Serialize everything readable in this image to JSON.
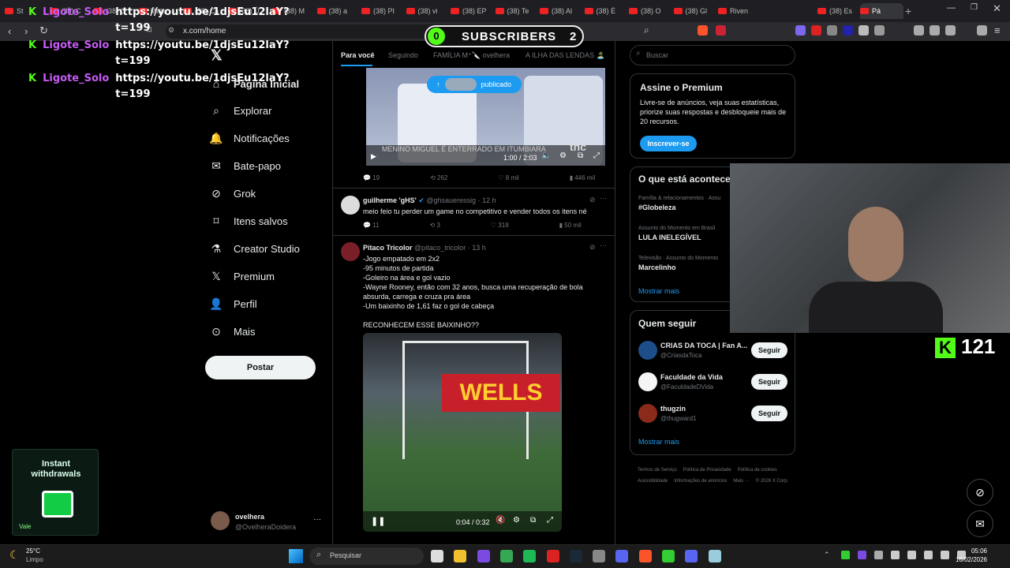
{
  "browser": {
    "tabs": [
      "St",
      "(38) C",
      "(38) O",
      "Male",
      "(38) Ca",
      "(38) Ú",
      "(38) M",
      "(38) a",
      "(38) PI",
      "(38) vi",
      "(38) EP",
      "(38) Te",
      "(38) Al",
      "(38) É",
      "(38) O",
      "(38) Gl",
      "Riven",
      "(38) Es",
      "Pá"
    ],
    "url": "x.com/home"
  },
  "stream": {
    "subscribers_label": "SUBSCRIBERS",
    "subscribers_left": "0",
    "subscribers_right": "2",
    "viewer_count": "121",
    "promo_title": "Instant withdrawals",
    "promo_badge": "Vale"
  },
  "chat": [
    {
      "user": "Ligote_Solo",
      "msg": "https://youtu.be/1djsEu12laY?t=199"
    },
    {
      "user": "Ligote_Solo",
      "msg": "https://youtu.be/1djsEu12laY?t=199"
    },
    {
      "user": "Ligote_Solo",
      "msg": "https://youtu.be/1djsEu12laY?t=199"
    }
  ],
  "nav": {
    "items": [
      "Página Inicial",
      "Explorar",
      "Notificações",
      "Bate-papo",
      "Grok",
      "Itens salvos",
      "Creator Studio",
      "Premium",
      "Perfil",
      "Mais"
    ],
    "post_label": "Postar",
    "account_name": "ovelhera",
    "account_handle": "@OvelheraDoidera"
  },
  "feed": {
    "tabs": [
      "Para você",
      "Seguindo",
      "FAMÍLIA M⁺🔪 ovelhera",
      "A ILHA DAS LENDAS 🏝️"
    ],
    "published_pill": "publicado",
    "video1": {
      "caption": "MENINO MIGUEL É ENTERRADO EM ITUMBIARA",
      "time": "1:00 / 2:03",
      "brand": "tnc"
    },
    "video1_stats": [
      "19",
      "262",
      "8 mil",
      "446 mil"
    ],
    "tweet2": {
      "name": "guilherme 'gHS'",
      "handle": "@ghsaueressig",
      "age": "12 h",
      "text": "meio feio tu perder um game no competitivo e vender todos os itens né",
      "stats": [
        "11",
        "3",
        "318",
        "50 mil"
      ]
    },
    "tweet3": {
      "name": "Pitaco Tricolor",
      "handle": "@pitaco_tricolor",
      "age": "13 h",
      "lines": [
        "-Jogo empatado em 2x2",
        "-95 minutos de partida",
        "-Goleiro na área e gol vazio",
        "-Wayne Rooney, então com 32 anos, busca uma recuperação de bola absurda, carrega e cruza pra área",
        "-Um baixinho de 1,61 faz o gol de cabeça",
        "",
        "RECONHECEM ESSE BAIXINHO??"
      ],
      "video_banner": "WELLS",
      "video_time": "0:04 / 0:32"
    }
  },
  "sidebar": {
    "search_placeholder": "Buscar",
    "premium": {
      "title": "Assine o Premium",
      "text": "Livre-se de anúncios, veja suas estatísticas, priorize suas respostas e desbloqueie mais de 20 recursos.",
      "button": "Inscrever-se"
    },
    "trends": {
      "title": "O que está acontece",
      "items": [
        {
          "meta": "Família & relacionamentos · Assu",
          "name": "#Globeleza"
        },
        {
          "meta": "Assunto do Momento em Brasil",
          "name": "LULA INELEGÍVEL"
        },
        {
          "meta": "Televisão · Assunto do Momento",
          "name": "Marcelinho"
        }
      ],
      "more": "Mostrar mais"
    },
    "who_to_follow": {
      "title": "Quem seguir",
      "items": [
        {
          "name": "CRIAS DA TOCA | Fan A...",
          "handle": "@CriasdaToca"
        },
        {
          "name": "Faculdade da Vida",
          "handle": "@FaculdadeDVida"
        },
        {
          "name": "thugzin",
          "handle": "@thugward1"
        }
      ],
      "follow_label": "Seguir",
      "more": "Mostrar mais"
    },
    "footer": [
      "Termos de Serviço",
      "Política de Privacidade",
      "Política de cookies",
      "Acessibilidade",
      "Informações de anúncios",
      "Mais ···",
      "© 2026 X Corp."
    ]
  },
  "taskbar": {
    "weather_temp": "25°C",
    "weather_desc": "Limpo",
    "search": "Pesquisar",
    "time": "05:06",
    "date": "16/02/2026"
  }
}
